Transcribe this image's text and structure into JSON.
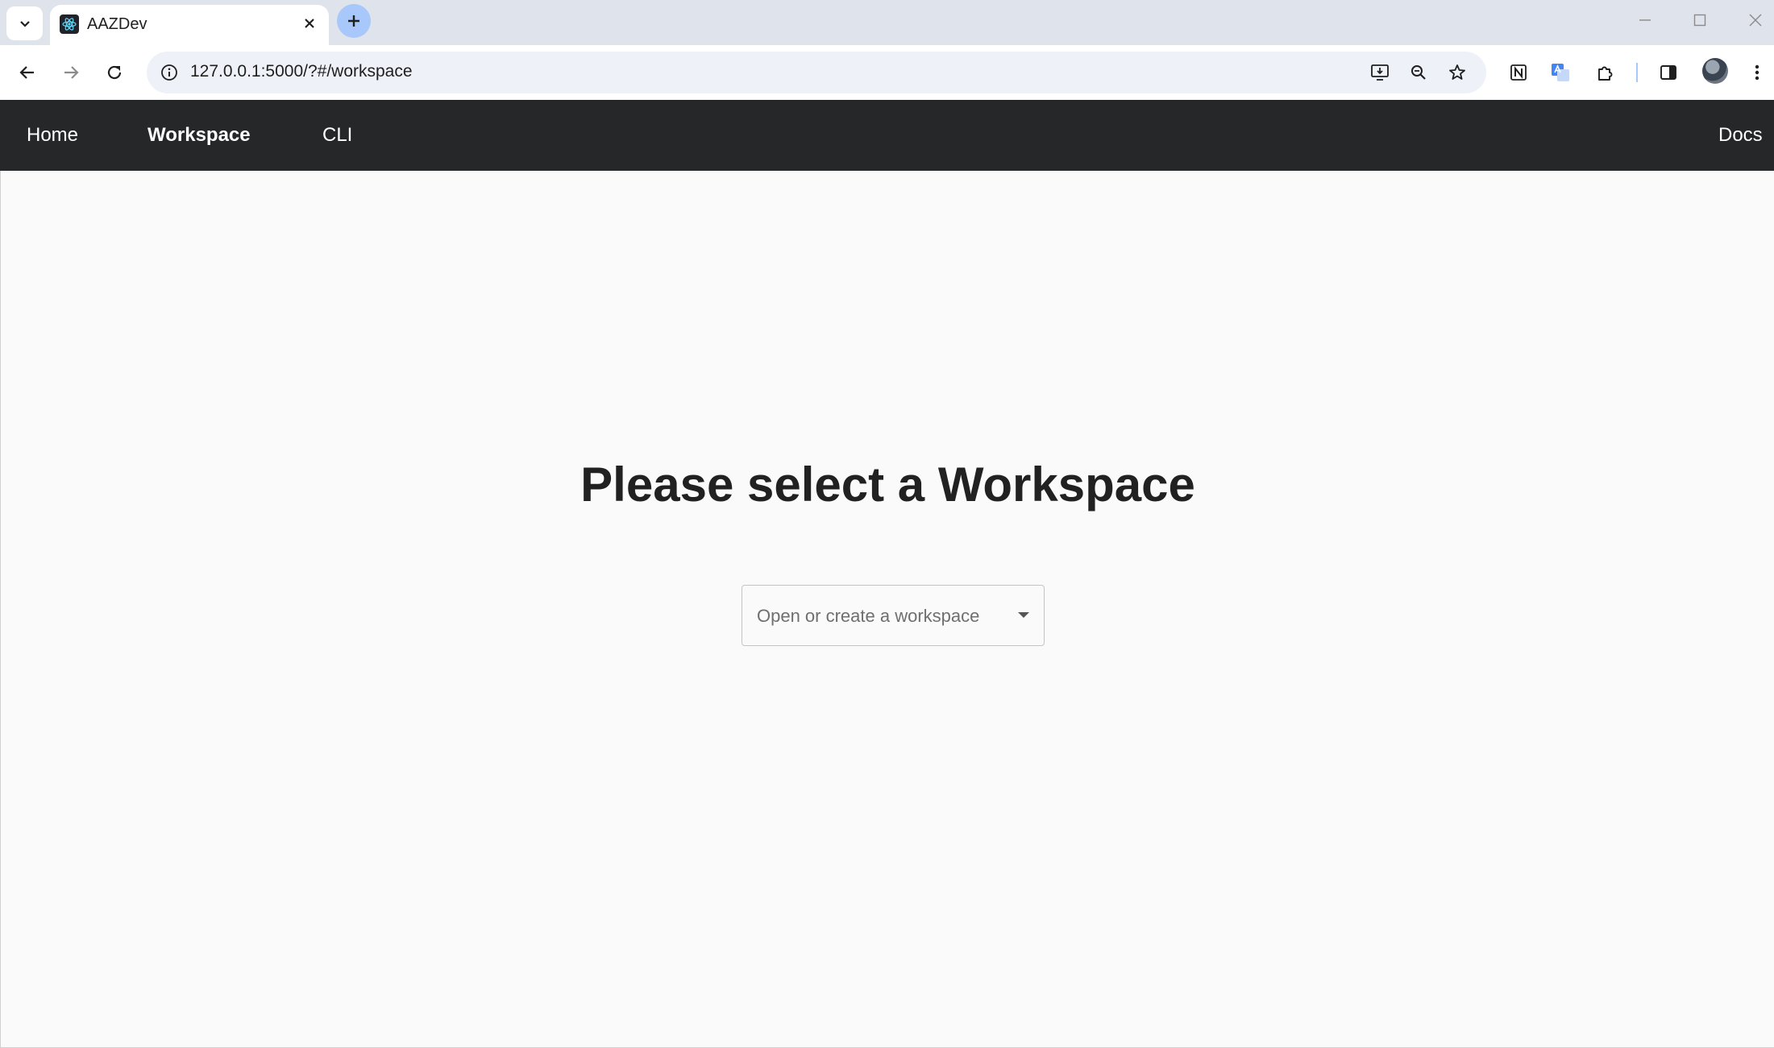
{
  "browser": {
    "tab": {
      "title": "AAZDev",
      "favicon": "react-logo-icon"
    },
    "url": "127.0.0.1:5000/?#/workspace",
    "toolbar_icons": [
      "back-icon",
      "forward-icon",
      "reload-icon",
      "site-info-icon",
      "install-app-icon",
      "zoom-icon",
      "bookmark-star-icon",
      "notion-extension-icon",
      "translate-extension-icon",
      "extensions-icon",
      "side-panel-icon",
      "profile-avatar",
      "more-menu-icon"
    ]
  },
  "navbar": {
    "items": [
      {
        "label": "Home"
      },
      {
        "label": "Workspace",
        "active": true
      },
      {
        "label": "CLI"
      }
    ],
    "right_label": "Docs",
    "background": "#262729"
  },
  "main": {
    "heading": "Please select a Workspace",
    "select": {
      "placeholder": "Open or create a workspace"
    }
  },
  "colors": {
    "tabstrip": "#dfe3eb",
    "new_tab_button": "#a8c7fa",
    "page_background": "#fafafa"
  }
}
